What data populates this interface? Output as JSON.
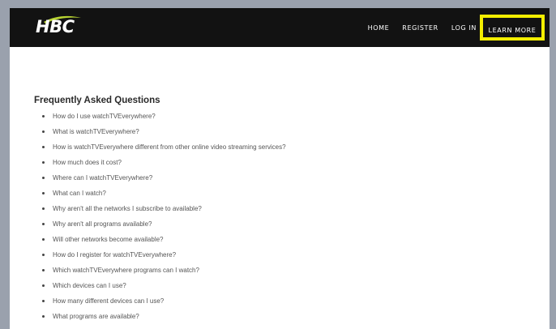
{
  "brand": {
    "logo_text": "HBC",
    "accent_color": "#b8d432"
  },
  "nav": {
    "items": [
      {
        "label": "HOME"
      },
      {
        "label": "REGISTER"
      },
      {
        "label": "LOG IN"
      },
      {
        "label": "LEARN MORE",
        "highlighted": true
      }
    ],
    "highlight_color": "#f3ee00",
    "bar_color": "#121212"
  },
  "faq": {
    "title": "Frequently Asked Questions",
    "questions": [
      "How do I use watchTVEverywhere?",
      "What is watchTVEverywhere?",
      "How is watchTVEverywhere different from other online video streaming services?",
      "How much does it cost?",
      "Where can I watchTVEverywhere?",
      "What can I watch?",
      "Why aren't all the networks I subscribe to available?",
      "Why aren't all programs available?",
      "Will other networks become available?",
      "How do I register for watchTVEverywhere?",
      "Which watchTVEverywhere programs can I watch?",
      "Which devices can I use?",
      "How many different devices can I use?",
      "What programs are available?"
    ]
  }
}
